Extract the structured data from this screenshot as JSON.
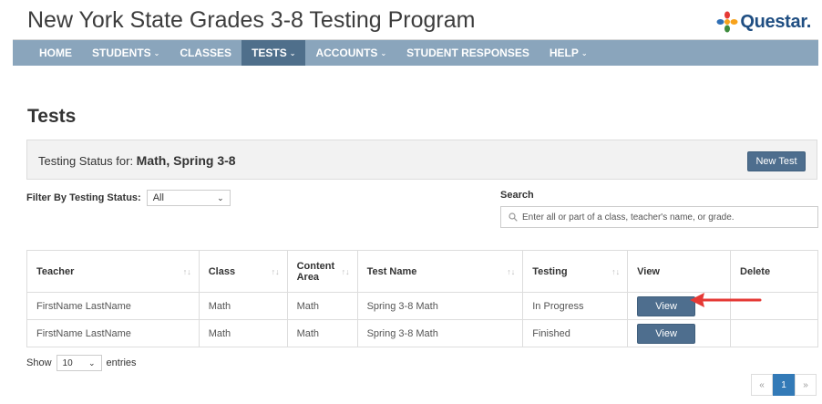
{
  "app": {
    "title": "New York State Grades 3-8 Testing Program",
    "brand": "Questar."
  },
  "nav": {
    "items": [
      {
        "label": "HOME",
        "dropdown": false
      },
      {
        "label": "STUDENTS",
        "dropdown": true
      },
      {
        "label": "CLASSES",
        "dropdown": false
      },
      {
        "label": "TESTS",
        "dropdown": true
      },
      {
        "label": "ACCOUNTS",
        "dropdown": true
      },
      {
        "label": "STUDENT RESPONSES",
        "dropdown": false
      },
      {
        "label": "HELP",
        "dropdown": true
      }
    ],
    "active": "TESTS"
  },
  "page": {
    "title": "Tests"
  },
  "status": {
    "label": "Testing Status for: ",
    "value": "Math, Spring 3-8",
    "new_test_label": "New Test"
  },
  "filter": {
    "label": "Filter By Testing Status:",
    "selected": "All"
  },
  "search": {
    "label": "Search",
    "placeholder": "Enter all or part of a class, teacher's name, or grade."
  },
  "table": {
    "headers": {
      "teacher": "Teacher",
      "class": "Class",
      "content_area": "Content Area",
      "test_name": "Test Name",
      "testing": "Testing",
      "view": "View",
      "delete": "Delete"
    },
    "rows": [
      {
        "teacher": "FirstName LastName",
        "class": "Math",
        "content_area": "Math",
        "test_name": "Spring 3-8 Math",
        "testing": "In Progress",
        "view_label": "View"
      },
      {
        "teacher": "FirstName LastName",
        "class": "Math",
        "content_area": "Math",
        "test_name": "Spring 3-8 Math",
        "testing": "Finished",
        "view_label": "View"
      }
    ]
  },
  "length": {
    "show_label": "Show",
    "value": "10",
    "entries_label": "entries"
  },
  "pagination": {
    "prev": "«",
    "current": "1",
    "next": "»"
  },
  "colors": {
    "nav_bg": "#8aa5bc",
    "nav_active": "#4f6f8b",
    "button": "#4e6e8e",
    "arrow": "#e53935",
    "page_active": "#337ab7"
  },
  "icons": {
    "search": "search-icon",
    "sort": "sort-icon",
    "arrow": "arrow-left-icon",
    "brand": "questar-logo-icon"
  }
}
